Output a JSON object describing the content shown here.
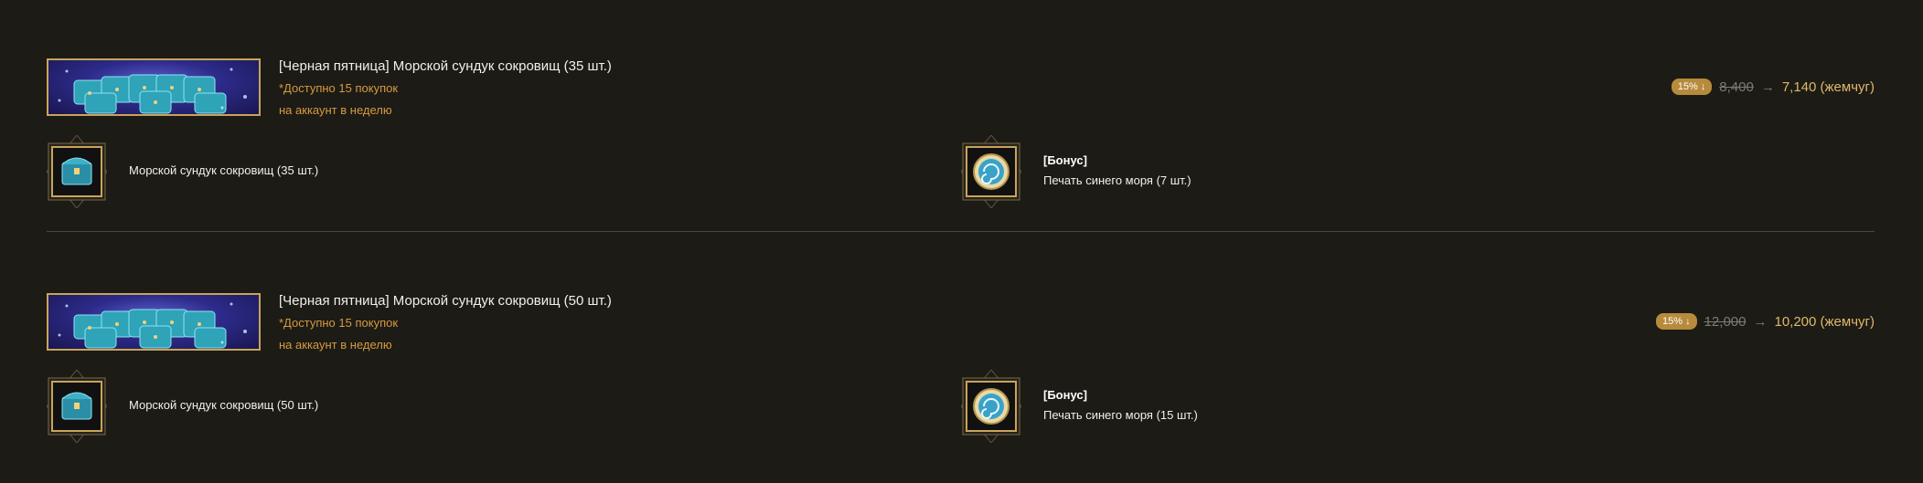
{
  "offers": [
    {
      "title": "[Черная пятница] Морской сундук сокровищ (35 шт.)",
      "note_line1": "*Доступно 15 покупок",
      "note_line2": "на аккаунт в неделю",
      "discount_badge": "15% ↓",
      "old_price": "8,400",
      "arrow": "→",
      "new_price": "7,140 (жемчуг)",
      "item_main": {
        "icon": "treasure-chest-icon",
        "label": "Морской сундук сокровищ (35 шт.)"
      },
      "item_bonus": {
        "icon": "blue-sea-seal-icon",
        "tag": "[Бонус]",
        "label": "Печать синего моря (7 шт.)"
      }
    },
    {
      "title": "[Черная пятница] Морской сундук сокровищ (50 шт.)",
      "note_line1": "*Доступно 15 покупок",
      "note_line2": "на аккаунт в неделю",
      "discount_badge": "15% ↓",
      "old_price": "12,000",
      "arrow": "→",
      "new_price": "10,200 (жемчуг)",
      "item_main": {
        "icon": "treasure-chest-icon",
        "label": "Морской сундук сокровищ (50 шт.)"
      },
      "item_bonus": {
        "icon": "blue-sea-seal-icon",
        "tag": "[Бонус]",
        "label": "Печать синего моря (15 шт.)"
      }
    }
  ],
  "colors": {
    "background": "#1c1b16",
    "accent_gold": "#c9a45a",
    "note_orange": "#d79a3f",
    "new_price": "#e0b86a",
    "badge": "#b78b3c"
  }
}
